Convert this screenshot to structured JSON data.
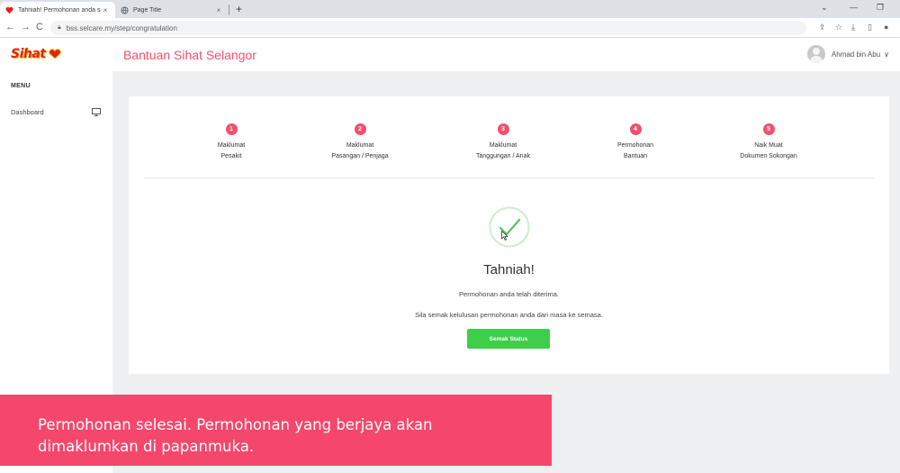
{
  "browser": {
    "tabs": [
      {
        "title": "Tahniah! Permohonan anda sudah...",
        "close": "×",
        "active": true
      },
      {
        "title": "Page Title",
        "close": "×",
        "active": false
      }
    ],
    "new_tab": "+",
    "url": "bss.selcare.my/step/congratulation",
    "window_controls": [
      "⌄",
      "—",
      "❐"
    ],
    "nav": {
      "back": "←",
      "forward": "→",
      "reload": "C"
    }
  },
  "app": {
    "logo_text": "Sihat",
    "title": "Bantuan Sihat Selangor",
    "user_name": "Ahmad bin Abu",
    "user_caret": "∨"
  },
  "sidebar": {
    "menu_label": "MENU",
    "items": [
      {
        "label": "Dashboard",
        "icon": "monitor-icon"
      }
    ]
  },
  "steps": [
    {
      "number": "1",
      "line1": "Maklumat",
      "line2": "Pesakit"
    },
    {
      "number": "2",
      "line1": "Maklumat",
      "line2": "Pasangan / Penjaga"
    },
    {
      "number": "3",
      "line1": "Maklumat",
      "line2": "Tanggungan / Anak"
    },
    {
      "number": "4",
      "line1": "Permohonan",
      "line2": "Bantuan"
    },
    {
      "number": "5",
      "line1": "Naik Muat",
      "line2": "Dokumen Sokongan"
    }
  ],
  "success": {
    "heading": "Tahniah!",
    "message1": "Permohonan anda telah diterima.",
    "message2": "Sila semak kelulusan permohonan anda dari masa ke semasa.",
    "button_label": "Semak Status"
  },
  "caption": {
    "line1": "Permohonan selesai. Permohonan yang berjaya akan",
    "line2": "dimaklumkan di papanmuka."
  },
  "colors": {
    "brand": "#f0506e",
    "success": "#3ecf4a",
    "caption_bg": "#f5476b"
  }
}
